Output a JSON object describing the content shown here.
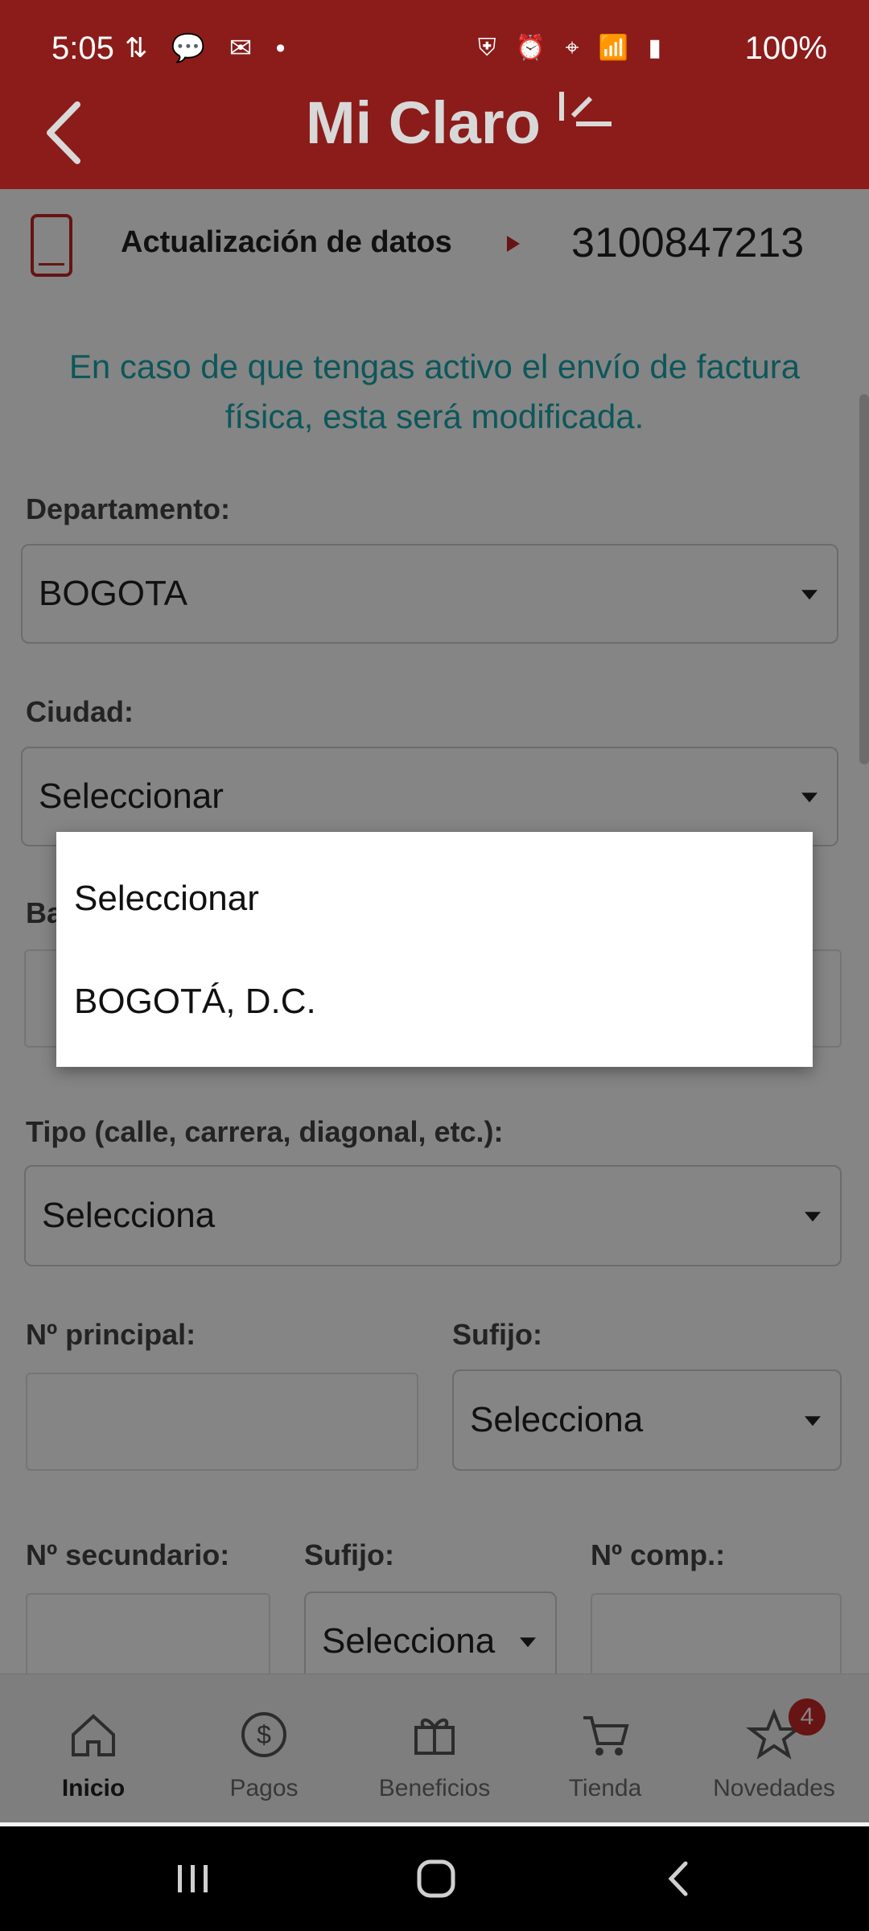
{
  "status_bar": {
    "time": "5:05",
    "battery": "100%",
    "left_icons": [
      "data-transfer-icon",
      "message-icon",
      "mail-icon",
      "dot-icon"
    ],
    "right_icons": [
      "security-icon",
      "alarm-icon",
      "location-icon",
      "wifi-icon",
      "volte-icon",
      "signal-icon",
      "battery-icon"
    ]
  },
  "header": {
    "brand": "Mi Claro"
  },
  "section": {
    "title": "Actualización de datos",
    "phone": "3100847213"
  },
  "info_text": "En caso de que tengas activo el envío de factura física, esta será modificada.",
  "form": {
    "departamento_label": "Departamento:",
    "departamento_value": "BOGOTA",
    "ciudad_label": "Ciudad:",
    "ciudad_value": "Seleccionar",
    "barrio_label_partial": "Ba",
    "tipo_label": "Tipo (calle, carrera, diagonal, etc.):",
    "tipo_value": "Selecciona",
    "principal_label": "Nº principal:",
    "sufijo1_label": "Sufijo:",
    "sufijo1_value": "Selecciona",
    "secundario_label": "Nº secundario:",
    "sufijo2_label": "Sufijo:",
    "sufijo2_value": "Selecciona",
    "comp_label": "Nº comp.:"
  },
  "dropdown": {
    "options": [
      "Seleccionar",
      "BOGOTÁ, D.C."
    ]
  },
  "bottom_nav": {
    "items": [
      {
        "label": "Inicio",
        "icon": "home-icon"
      },
      {
        "label": "Pagos",
        "icon": "dollar-icon"
      },
      {
        "label": "Beneficios",
        "icon": "gift-icon"
      },
      {
        "label": "Tienda",
        "icon": "cart-icon"
      },
      {
        "label": "Novedades",
        "icon": "star-icon"
      }
    ],
    "badge": "4"
  },
  "colors": {
    "header_bg": "#8b1c1a",
    "accent_red": "#c62828",
    "info_teal": "#1aa7ad"
  }
}
